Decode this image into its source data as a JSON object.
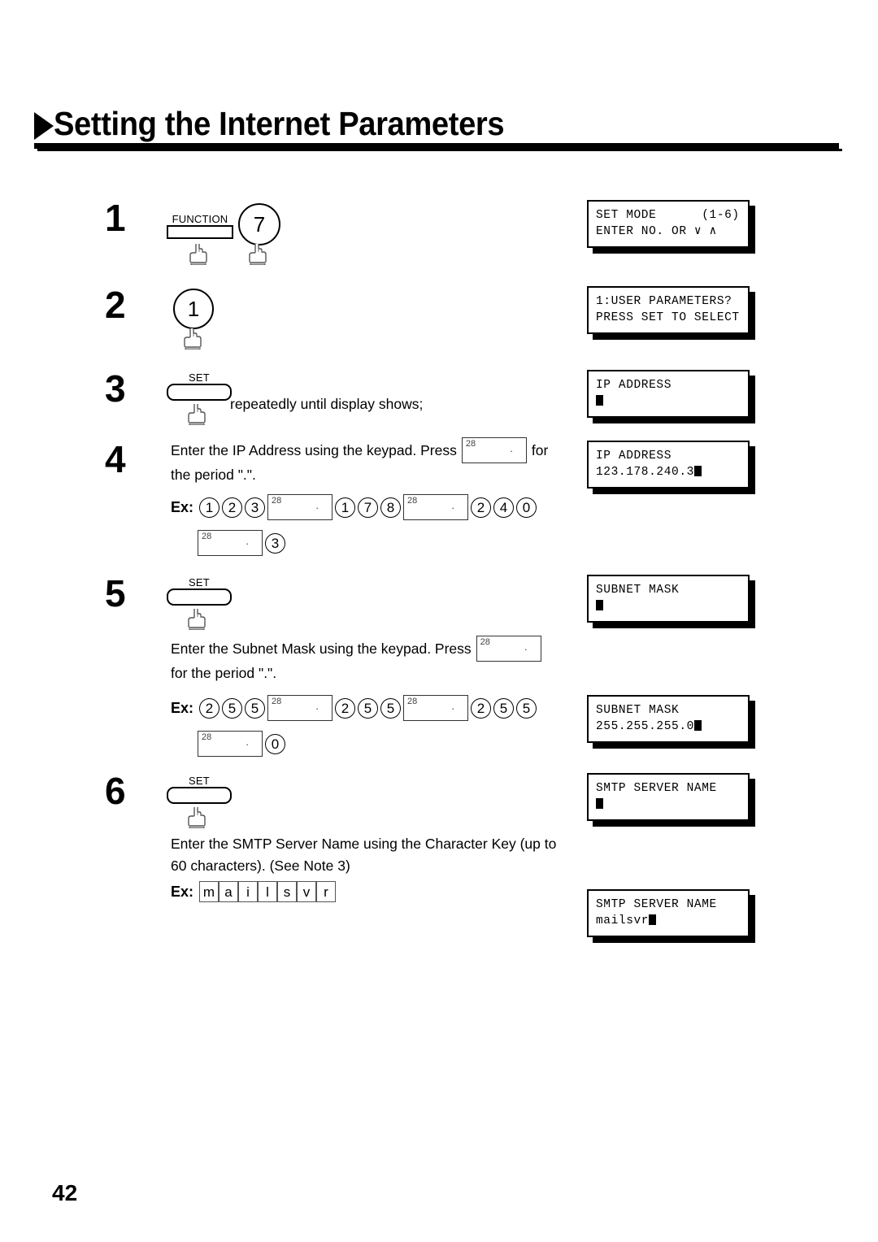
{
  "document": {
    "title": "Setting the Internet Parameters",
    "page_number": "42"
  },
  "keys": {
    "function_label": "FUNCTION",
    "set_label": "SET",
    "period_key_number": "28",
    "period_key_dot": "."
  },
  "steps": [
    {
      "number": "1",
      "keys": [
        "FUNCTION",
        "7"
      ]
    },
    {
      "number": "2",
      "keys": [
        "1"
      ]
    },
    {
      "number": "3",
      "keys": [
        "SET"
      ],
      "text": "repeatedly until display shows;"
    },
    {
      "number": "4",
      "text_before": "Enter the IP Address using the keypad. Press",
      "text_after": "for",
      "text_line2": "the period \".\".",
      "ex_label": "Ex:",
      "ex_sequence_line1": [
        "1",
        "2",
        "3",
        "PERIOD",
        "1",
        "7",
        "8",
        "PERIOD",
        "2",
        "4",
        "0"
      ],
      "ex_sequence_line2": [
        "PERIOD",
        "3"
      ]
    },
    {
      "number": "5",
      "keys": [
        "SET"
      ],
      "text_before": "Enter the Subnet Mask using the keypad.  Press",
      "text_line2": "for the period \".\".",
      "ex_label": "Ex:",
      "ex_sequence_line1": [
        "2",
        "5",
        "5",
        "PERIOD",
        "2",
        "5",
        "5",
        "PERIOD",
        "2",
        "5",
        "5"
      ],
      "ex_sequence_line2": [
        "PERIOD",
        "0"
      ]
    },
    {
      "number": "6",
      "keys": [
        "SET"
      ],
      "text_line1": "Enter the SMTP Server Name using the Character Key (up to",
      "text_line2": "60 characters). (See Note 3)",
      "ex_label": "Ex:",
      "ex_characters": [
        "m",
        "a",
        "i",
        "l",
        "s",
        "v",
        "r"
      ]
    }
  ],
  "displays": [
    {
      "id": "set-mode",
      "line1": "SET MODE      (1-6)",
      "line2": "ENTER NO. OR ∨ ∧",
      "cursor": false
    },
    {
      "id": "user-parameters",
      "line1": "1:USER PARAMETERS?",
      "line2": "PRESS SET TO SELECT",
      "cursor": false
    },
    {
      "id": "ip-address-empty",
      "line1": "IP ADDRESS",
      "line2": "",
      "cursor": true
    },
    {
      "id": "ip-address-filled",
      "line1": "IP ADDRESS",
      "line2": "123.178.240.3",
      "cursor": true
    },
    {
      "id": "subnet-mask-empty",
      "line1": "SUBNET MASK",
      "line2": "",
      "cursor": true
    },
    {
      "id": "subnet-mask-filled",
      "line1": "SUBNET MASK",
      "line2": "255.255.255.0",
      "cursor": true
    },
    {
      "id": "smtp-server-empty",
      "line1": "SMTP SERVER NAME",
      "line2": "",
      "cursor": true
    },
    {
      "id": "smtp-server-filled",
      "line1": "SMTP SERVER NAME",
      "line2": "mailsvr",
      "cursor": true
    }
  ]
}
